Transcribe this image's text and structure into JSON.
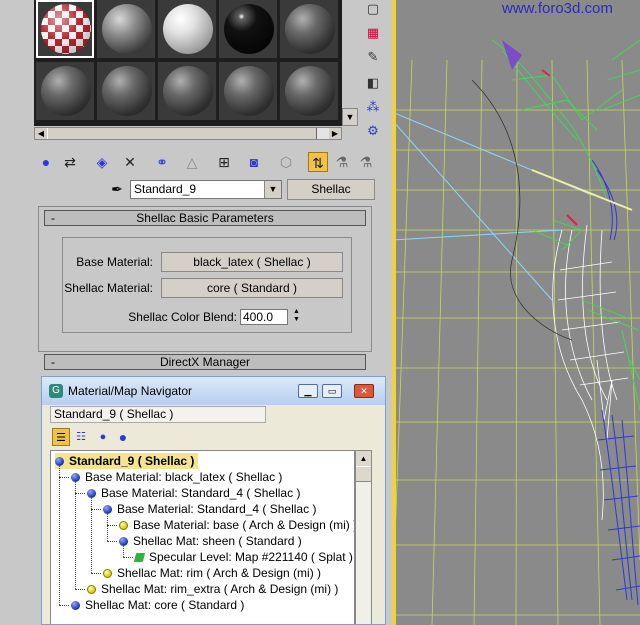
{
  "watermark": "www.foro3d.com",
  "material_slots": [
    {
      "style": "checker",
      "selected": true
    },
    {
      "style": "grey"
    },
    {
      "style": "white"
    },
    {
      "style": "black"
    },
    {
      "style": "dark"
    },
    {
      "style": "dark"
    },
    {
      "style": "dark"
    },
    {
      "style": "dark"
    },
    {
      "style": "dark"
    },
    {
      "style": "dark"
    }
  ],
  "toolbar_icons": [
    "get-material-icon",
    "put-to-scene-icon",
    "assign-to-selection-icon",
    "delete-icon",
    "make-unique-icon",
    "put-to-library-icon",
    "material-id-icon",
    "show-map-icon",
    "show-end-result-icon",
    "go-to-parent-active-icon",
    "go-forward-icon",
    "pick-icon"
  ],
  "material": {
    "name": "Standard_9",
    "type_button": "Shellac"
  },
  "rollouts": {
    "basic_title": "Shellac Basic Parameters",
    "directx_title": "DirectX Manager",
    "collapse_symbol": "-"
  },
  "params": {
    "base_label": "Base Material:",
    "base_value": "black_latex  ( Shellac )",
    "shellac_label": "Shellac Material:",
    "shellac_value": "core  ( Standard )",
    "blend_label": "Shellac Color Blend:",
    "blend_value": "400.0"
  },
  "navigator": {
    "title": "Material/Map Navigator",
    "field": "Standard_9  ( Shellac )",
    "tree": [
      {
        "label": "Standard_9  ( Shellac )",
        "icon": "blue",
        "depth": 0,
        "root": true
      },
      {
        "label": "Base Material: black_latex  ( Shellac )",
        "icon": "blue",
        "depth": 1
      },
      {
        "label": "Base Material: Standard_4  ( Shellac )",
        "icon": "blue",
        "depth": 2
      },
      {
        "label": "Base Material: Standard_4  ( Shellac )",
        "icon": "blue",
        "depth": 3
      },
      {
        "label": "Base Material: base  ( Arch & Design (mi) )",
        "icon": "yellow",
        "depth": 4
      },
      {
        "label": "Shellac Mat: sheen  ( Standard )",
        "icon": "blue",
        "depth": 4
      },
      {
        "label": "Specular Level: Map #221140  ( Splat )",
        "icon": "green",
        "depth": 5
      },
      {
        "label": "Shellac Mat: rim  ( Arch & Design (mi) )",
        "icon": "yellow",
        "depth": 3
      },
      {
        "label": "Shellac Mat: rim_extra  ( Arch & Design (mi) )",
        "icon": "yellow",
        "depth": 2
      },
      {
        "label": "Shellac Mat: core  ( Standard )",
        "icon": "blue",
        "depth": 1
      }
    ]
  },
  "colors": {
    "viewport_grid": "#d4e64a",
    "wire_green": "#38e04a",
    "wire_blue": "#2a3ad8",
    "wire_white": "#ffffff",
    "highlight": "#f1c24a"
  }
}
